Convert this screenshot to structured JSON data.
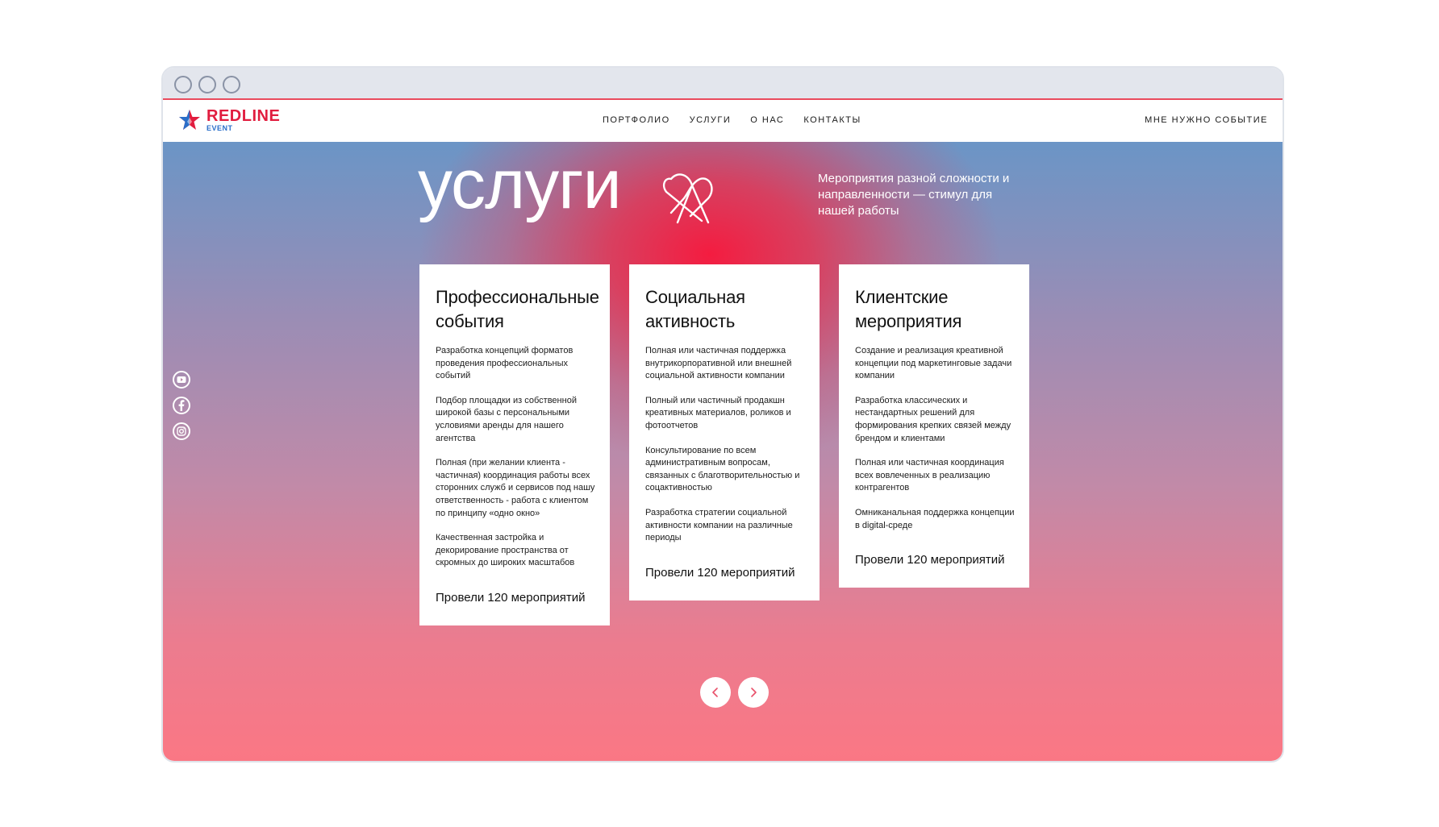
{
  "logo": {
    "brand": "REDLINE",
    "sub": "EVENT"
  },
  "nav": {
    "items": [
      "ПОРТФОЛИО",
      "УСЛУГИ",
      "О НАС",
      "КОНТАКТЫ"
    ],
    "cta": "МНЕ НУЖНО СОБЫТИЕ"
  },
  "hero": {
    "title": "услуги",
    "subtitle": "Мероприятия разной сложности и направленности — стимул для нашей работы"
  },
  "social": [
    "youtube-icon",
    "facebook-icon",
    "instagram-icon"
  ],
  "cards": [
    {
      "title_line1": "Профессиональные",
      "title_line2": "события",
      "bullets": [
        "Разработка концепций форматов проведения профессиональных событий",
        "Подбор площадки из собственной широкой базы с персональными условиями аренды для нашего агентства",
        "Полная (при желании клиента - частичная) координация работы всех сторонних служб и сервисов под нашу ответственность - работа с клиентом по принципу «одно окно»",
        "Качественная застройка и декорирование пространства от скромных до широких масштабов"
      ],
      "count": "Провели 120 мероприятий"
    },
    {
      "title_line1": "Социальная",
      "title_line2": "активность",
      "bullets": [
        "Полная или частичная поддержка внутрикорпоративной или внешней социальной активности компании",
        "Полный или частичный продакшн креативных материалов, роликов и фотоотчетов",
        "Консультирование по всем административным вопросам, связанных с благотворительностью и соцактивностью",
        "Разработка стратегии социальной активности компании на различные периоды"
      ],
      "count": "Провели 120 мероприятий"
    },
    {
      "title_line1": "Клиентские",
      "title_line2": "мероприятия",
      "bullets": [
        "Создание и реализация креативной концепции под маркетинговые задачи компании",
        "Разработка классических и нестандартных решений для формирования крепких связей между брендом и клиентами",
        "Полная или частичная координация всех вовлеченных в реализацию контрагентов",
        "Омниканальная поддержка концепции в digital-среде"
      ],
      "count": "Провели 120 мероприятий"
    }
  ],
  "carousel": {
    "prev_icon": "chevron-left-icon",
    "next_icon": "chevron-right-icon"
  },
  "colors": {
    "brand_red": "#e11d3f",
    "brand_blue": "#2a6fc9",
    "hero_top": "#6b95c6",
    "hero_bottom": "#fb7784",
    "hero_glow": "#f41c40",
    "chrome_accent": "#e94b5d"
  }
}
